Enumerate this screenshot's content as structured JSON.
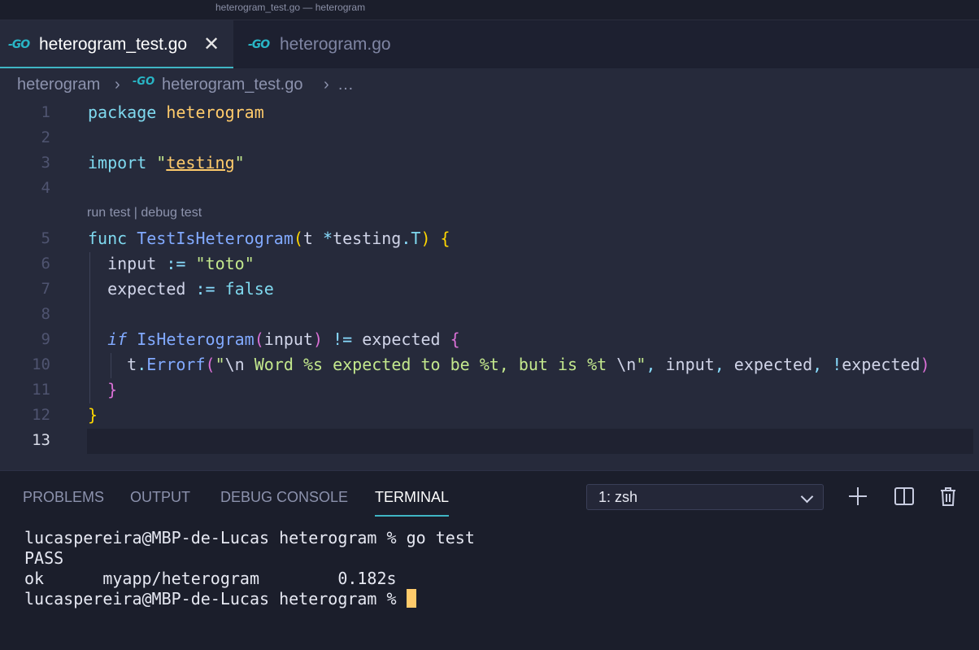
{
  "window": {
    "title": "heterogram_test.go — heterogram"
  },
  "tabs": [
    {
      "icon": "go-icon",
      "label": "heterogram_test.go",
      "active": true
    },
    {
      "icon": "go-icon",
      "label": "heterogram.go",
      "active": false
    }
  ],
  "breadcrumb": {
    "folder": "heterogram",
    "file": "heterogram_test.go",
    "more": "…"
  },
  "editor": {
    "line_numbers": [
      "1",
      "2",
      "3",
      "4",
      "5",
      "6",
      "7",
      "8",
      "9",
      "10",
      "11",
      "12",
      "13"
    ],
    "current_line": "13",
    "codelens": {
      "run": "run test",
      "separator": " | ",
      "debug": "debug test"
    },
    "code": {
      "l1_kw": "package",
      "l1_pkg": "heterogram",
      "l3_kw": "import",
      "l3_q1": "\"",
      "l3_str": "testing",
      "l3_q2": "\"",
      "l5_kw": "func",
      "l5_fn": "TestIsHeterogram",
      "l5_p1": "(",
      "l5_t": "t ",
      "l5_star": "*",
      "l5_pk": "testing",
      "l5_dot": ".",
      "l5_T": "T",
      "l5_p2": ")",
      "l5_b": "{",
      "l6_id": "input",
      "l6_op": ":=",
      "l6_str": "\"toto\"",
      "l7_id": "expected",
      "l7_op": ":=",
      "l7_cst": "false",
      "l9_kw": "if",
      "l9_fn": "IsHeterogram",
      "l9_p1": "(",
      "l9_arg": "input",
      "l9_p2": ")",
      "l9_op": "!=",
      "l9_id": "expected",
      "l9_b": "{",
      "l10_t": "t",
      "l10_dot": ".",
      "l10_fn": "Errorf",
      "l10_p1": "(",
      "l10_q1": "\"",
      "l10_esc1": "\\n",
      "l10_str": " Word %s expected to be %t, but is %t ",
      "l10_esc2": "\\n",
      "l10_q2": "\"",
      "l10_c1": ",",
      "l10_a1": " input",
      "l10_c2": ",",
      "l10_a2": " expected",
      "l10_c3": ",",
      "l10_not": " !",
      "l10_a3": "expected",
      "l10_p2": ")",
      "l11_b": "}",
      "l12_b": "}"
    }
  },
  "panel": {
    "tabs": [
      "PROBLEMS",
      "OUTPUT",
      "DEBUG CONSOLE",
      "TERMINAL"
    ],
    "active_tab": "TERMINAL",
    "shell_select": {
      "value": "1: zsh"
    },
    "actions": [
      "plus-icon",
      "split-icon",
      "trash-icon"
    ],
    "terminal_lines": [
      "lucaspereira@MBP-de-Lucas heterogram % go test",
      "PASS",
      "ok      myapp/heterogram        0.182s",
      "lucaspereira@MBP-de-Lucas heterogram % "
    ]
  },
  "colors": {
    "accent": "#3fb5c4",
    "cursor": "#ffcb6b",
    "editor_bg": "#262a3b",
    "panel_bg": "#1b1e2b"
  }
}
